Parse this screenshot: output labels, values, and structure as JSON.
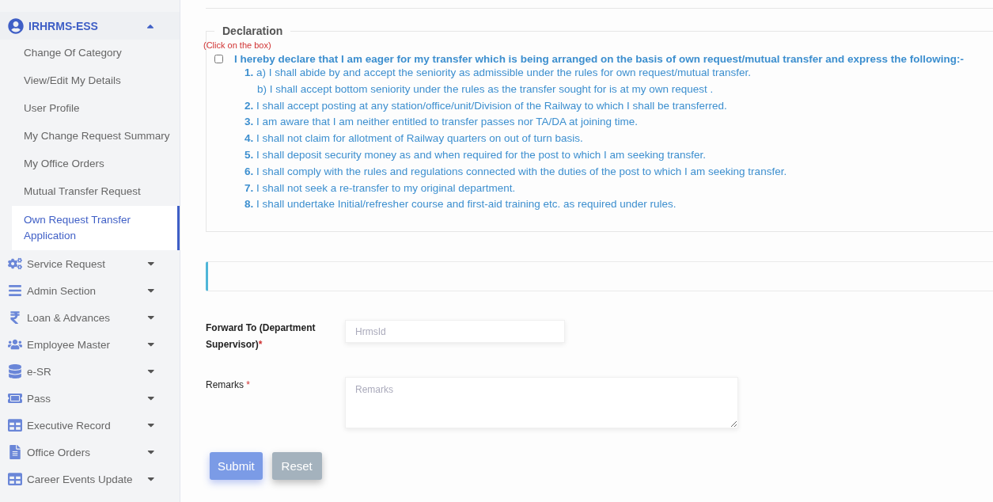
{
  "sidebar": {
    "header": {
      "label": "IRHRMS-ESS",
      "expanded": true
    },
    "subitems": [
      {
        "label": "Change Of Category",
        "selected": false
      },
      {
        "label": "View/Edit My Details",
        "selected": false
      },
      {
        "label": "User Profile",
        "selected": false
      },
      {
        "label": "My Change Request Summary",
        "selected": false
      },
      {
        "label": "My Office Orders",
        "selected": false
      },
      {
        "label": "Mutual Transfer Request",
        "selected": false
      },
      {
        "label": "Own Request Transfer Application",
        "selected": true
      }
    ],
    "menus": [
      {
        "label": "Service Request",
        "expanded": false
      },
      {
        "label": "Admin Section",
        "expanded": false
      },
      {
        "label": "Loan & Advances",
        "expanded": false
      },
      {
        "label": "Employee Master",
        "expanded": false
      },
      {
        "label": "e-SR",
        "expanded": false
      },
      {
        "label": "Pass",
        "expanded": false
      },
      {
        "label": "Executive Record",
        "expanded": false
      },
      {
        "label": "Office Orders",
        "expanded": false
      },
      {
        "label": "Career Events Update",
        "expanded": false
      }
    ]
  },
  "declaration": {
    "legend": "Declaration",
    "hint": "(Click on the box)",
    "checked": false,
    "statement": "I hereby declare that I am eager for my transfer which is being arranged on the basis of own request/mutual transfer and express the following:-",
    "items": [
      {
        "number": "1.",
        "text": "a) I shall abide by and accept the seniority as admissible under the rules for own request/mutual transfer."
      },
      {
        "text": "b) I shall accept bottom seniority under the rules as the transfer sought for is at my own request ."
      },
      {
        "number": "2.",
        "text": "I shall accept posting at any station/office/unit/Division of the Railway to which I shall be transferred."
      },
      {
        "number": "3.",
        "text": "I am aware that I am neither entitled to transfer passes nor TA/DA at joining time."
      },
      {
        "number": "4.",
        "text": "I shall not claim for allotment of Railway quarters on out of turn basis."
      },
      {
        "number": "5.",
        "text": "I shall deposit security money as and when required for the post to which I am seeking transfer."
      },
      {
        "number": "6.",
        "text": "I shall comply with the rules and regulations connected with the duties of the post to which I am seeking transfer."
      },
      {
        "number": "7.",
        "text": "I shall not seek a re-transfer to my original department."
      },
      {
        "number": "8.",
        "text": "I shall undertake Initial/refresher course and first-aid training etc. as required under rules."
      }
    ]
  },
  "form": {
    "forward_to": {
      "label": "Forward To (Department Supervisor)",
      "required_mark": "*",
      "placeholder": "HrmsId"
    },
    "remarks": {
      "label": "Remarks",
      "required_mark": "*",
      "placeholder": "Remarks"
    },
    "buttons": [
      {
        "label": "Submit",
        "kind": "primary"
      },
      {
        "label": "Reset",
        "kind": "secondary"
      }
    ]
  }
}
